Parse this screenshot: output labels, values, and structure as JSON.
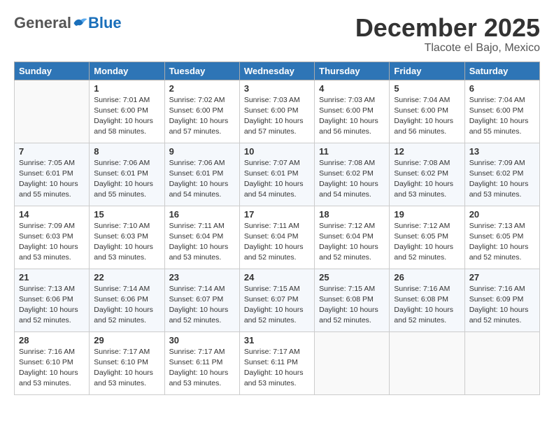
{
  "logo": {
    "general": "General",
    "blue": "Blue"
  },
  "title": "December 2025",
  "subtitle": "Tlacote el Bajo, Mexico",
  "weekdays": [
    "Sunday",
    "Monday",
    "Tuesday",
    "Wednesday",
    "Thursday",
    "Friday",
    "Saturday"
  ],
  "weeks": [
    [
      {
        "day": "",
        "sunrise": "",
        "sunset": "",
        "daylight": ""
      },
      {
        "day": "1",
        "sunrise": "Sunrise: 7:01 AM",
        "sunset": "Sunset: 6:00 PM",
        "daylight": "Daylight: 10 hours and 58 minutes."
      },
      {
        "day": "2",
        "sunrise": "Sunrise: 7:02 AM",
        "sunset": "Sunset: 6:00 PM",
        "daylight": "Daylight: 10 hours and 57 minutes."
      },
      {
        "day": "3",
        "sunrise": "Sunrise: 7:03 AM",
        "sunset": "Sunset: 6:00 PM",
        "daylight": "Daylight: 10 hours and 57 minutes."
      },
      {
        "day": "4",
        "sunrise": "Sunrise: 7:03 AM",
        "sunset": "Sunset: 6:00 PM",
        "daylight": "Daylight: 10 hours and 56 minutes."
      },
      {
        "day": "5",
        "sunrise": "Sunrise: 7:04 AM",
        "sunset": "Sunset: 6:00 PM",
        "daylight": "Daylight: 10 hours and 56 minutes."
      },
      {
        "day": "6",
        "sunrise": "Sunrise: 7:04 AM",
        "sunset": "Sunset: 6:00 PM",
        "daylight": "Daylight: 10 hours and 55 minutes."
      }
    ],
    [
      {
        "day": "7",
        "sunrise": "Sunrise: 7:05 AM",
        "sunset": "Sunset: 6:01 PM",
        "daylight": "Daylight: 10 hours and 55 minutes."
      },
      {
        "day": "8",
        "sunrise": "Sunrise: 7:06 AM",
        "sunset": "Sunset: 6:01 PM",
        "daylight": "Daylight: 10 hours and 55 minutes."
      },
      {
        "day": "9",
        "sunrise": "Sunrise: 7:06 AM",
        "sunset": "Sunset: 6:01 PM",
        "daylight": "Daylight: 10 hours and 54 minutes."
      },
      {
        "day": "10",
        "sunrise": "Sunrise: 7:07 AM",
        "sunset": "Sunset: 6:01 PM",
        "daylight": "Daylight: 10 hours and 54 minutes."
      },
      {
        "day": "11",
        "sunrise": "Sunrise: 7:08 AM",
        "sunset": "Sunset: 6:02 PM",
        "daylight": "Daylight: 10 hours and 54 minutes."
      },
      {
        "day": "12",
        "sunrise": "Sunrise: 7:08 AM",
        "sunset": "Sunset: 6:02 PM",
        "daylight": "Daylight: 10 hours and 53 minutes."
      },
      {
        "day": "13",
        "sunrise": "Sunrise: 7:09 AM",
        "sunset": "Sunset: 6:02 PM",
        "daylight": "Daylight: 10 hours and 53 minutes."
      }
    ],
    [
      {
        "day": "14",
        "sunrise": "Sunrise: 7:09 AM",
        "sunset": "Sunset: 6:03 PM",
        "daylight": "Daylight: 10 hours and 53 minutes."
      },
      {
        "day": "15",
        "sunrise": "Sunrise: 7:10 AM",
        "sunset": "Sunset: 6:03 PM",
        "daylight": "Daylight: 10 hours and 53 minutes."
      },
      {
        "day": "16",
        "sunrise": "Sunrise: 7:11 AM",
        "sunset": "Sunset: 6:04 PM",
        "daylight": "Daylight: 10 hours and 53 minutes."
      },
      {
        "day": "17",
        "sunrise": "Sunrise: 7:11 AM",
        "sunset": "Sunset: 6:04 PM",
        "daylight": "Daylight: 10 hours and 52 minutes."
      },
      {
        "day": "18",
        "sunrise": "Sunrise: 7:12 AM",
        "sunset": "Sunset: 6:04 PM",
        "daylight": "Daylight: 10 hours and 52 minutes."
      },
      {
        "day": "19",
        "sunrise": "Sunrise: 7:12 AM",
        "sunset": "Sunset: 6:05 PM",
        "daylight": "Daylight: 10 hours and 52 minutes."
      },
      {
        "day": "20",
        "sunrise": "Sunrise: 7:13 AM",
        "sunset": "Sunset: 6:05 PM",
        "daylight": "Daylight: 10 hours and 52 minutes."
      }
    ],
    [
      {
        "day": "21",
        "sunrise": "Sunrise: 7:13 AM",
        "sunset": "Sunset: 6:06 PM",
        "daylight": "Daylight: 10 hours and 52 minutes."
      },
      {
        "day": "22",
        "sunrise": "Sunrise: 7:14 AM",
        "sunset": "Sunset: 6:06 PM",
        "daylight": "Daylight: 10 hours and 52 minutes."
      },
      {
        "day": "23",
        "sunrise": "Sunrise: 7:14 AM",
        "sunset": "Sunset: 6:07 PM",
        "daylight": "Daylight: 10 hours and 52 minutes."
      },
      {
        "day": "24",
        "sunrise": "Sunrise: 7:15 AM",
        "sunset": "Sunset: 6:07 PM",
        "daylight": "Daylight: 10 hours and 52 minutes."
      },
      {
        "day": "25",
        "sunrise": "Sunrise: 7:15 AM",
        "sunset": "Sunset: 6:08 PM",
        "daylight": "Daylight: 10 hours and 52 minutes."
      },
      {
        "day": "26",
        "sunrise": "Sunrise: 7:16 AM",
        "sunset": "Sunset: 6:08 PM",
        "daylight": "Daylight: 10 hours and 52 minutes."
      },
      {
        "day": "27",
        "sunrise": "Sunrise: 7:16 AM",
        "sunset": "Sunset: 6:09 PM",
        "daylight": "Daylight: 10 hours and 52 minutes."
      }
    ],
    [
      {
        "day": "28",
        "sunrise": "Sunrise: 7:16 AM",
        "sunset": "Sunset: 6:10 PM",
        "daylight": "Daylight: 10 hours and 53 minutes."
      },
      {
        "day": "29",
        "sunrise": "Sunrise: 7:17 AM",
        "sunset": "Sunset: 6:10 PM",
        "daylight": "Daylight: 10 hours and 53 minutes."
      },
      {
        "day": "30",
        "sunrise": "Sunrise: 7:17 AM",
        "sunset": "Sunset: 6:11 PM",
        "daylight": "Daylight: 10 hours and 53 minutes."
      },
      {
        "day": "31",
        "sunrise": "Sunrise: 7:17 AM",
        "sunset": "Sunset: 6:11 PM",
        "daylight": "Daylight: 10 hours and 53 minutes."
      },
      {
        "day": "",
        "sunrise": "",
        "sunset": "",
        "daylight": ""
      },
      {
        "day": "",
        "sunrise": "",
        "sunset": "",
        "daylight": ""
      },
      {
        "day": "",
        "sunrise": "",
        "sunset": "",
        "daylight": ""
      }
    ]
  ]
}
